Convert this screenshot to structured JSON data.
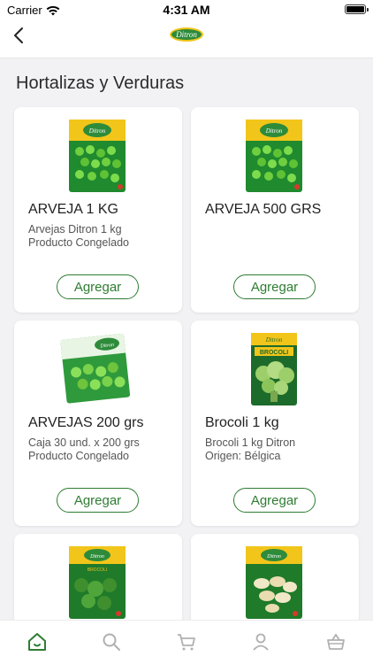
{
  "status": {
    "carrier": "Carrier",
    "time": "4:31 AM"
  },
  "nav": {
    "logo_text": "Ditron"
  },
  "section": {
    "title": "Hortalizas y Verduras"
  },
  "products": [
    {
      "name": "ARVEJA 1 KG",
      "desc1": "Arvejas Ditron 1 kg",
      "desc2": "Producto Congelado",
      "button": "Agregar",
      "pack_label": "Ditron"
    },
    {
      "name": "ARVEJA 500 GRS",
      "desc1": "",
      "desc2": "",
      "button": "Agregar",
      "pack_label": "Ditron"
    },
    {
      "name": "ARVEJAS 200 grs",
      "desc1": "Caja 30 und. x 200 grs",
      "desc2": "Producto Congelado",
      "button": "Agregar",
      "pack_label": "Ditron"
    },
    {
      "name": "Brocoli 1 kg",
      "desc1": "Brocoli 1 kg Ditron",
      "desc2": "Origen: Bélgica",
      "button": "Agregar",
      "pack_label": "BROCOLI"
    },
    {
      "name": "",
      "desc1": "",
      "desc2": "",
      "button": "",
      "pack_label": "BROCOLI"
    },
    {
      "name": "",
      "desc1": "",
      "desc2": "",
      "button": "",
      "pack_label": "Ditron"
    }
  ],
  "tabs": [
    "home-icon",
    "search-icon",
    "cart-icon",
    "user-icon",
    "basket-icon"
  ],
  "colors": {
    "accent": "#2e7d32",
    "background": "#f2f2f4",
    "tab_active": "#2e7d32",
    "tab_inactive": "#b0b0b0"
  }
}
